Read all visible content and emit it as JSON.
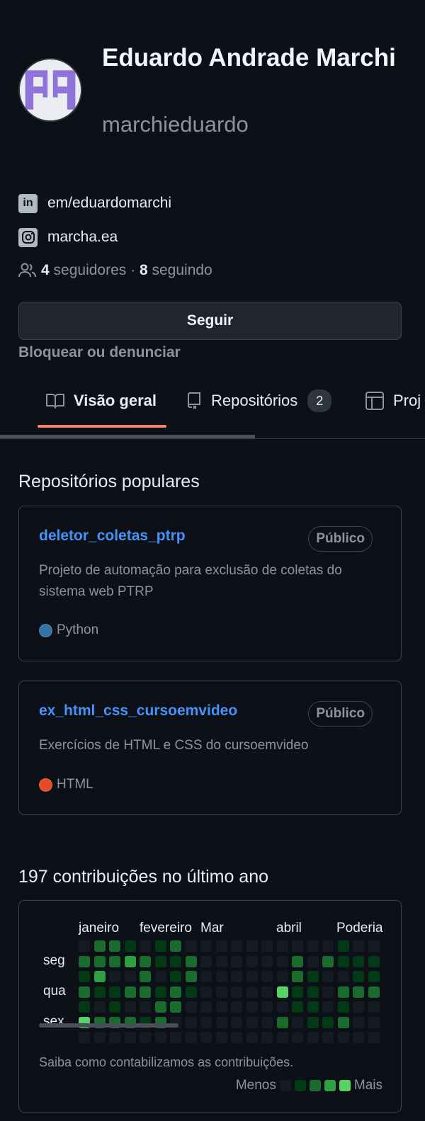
{
  "profile": {
    "name": "Eduardo Andrade Marchi",
    "login": "marchieduardo",
    "linkedin": "em/eduardomarchi",
    "instagram": "marcha.ea",
    "followers_count": "4",
    "followers_label": "seguidores",
    "separator": "·",
    "following_count": "8",
    "following_label": "seguindo",
    "follow_button": "Seguir",
    "block_link": "Bloquear ou denunciar"
  },
  "tabs": [
    {
      "label": "Visão geral",
      "icon": "book-icon",
      "selected": true
    },
    {
      "label": "Repositórios",
      "icon": "repo-icon",
      "count": "2"
    },
    {
      "label": "Proj",
      "icon": "table-icon"
    }
  ],
  "popular": {
    "title": "Repositórios populares",
    "repos": [
      {
        "name": "deletor_coletas_ptrp",
        "visibility": "Público",
        "description": "Projeto de automação para exclusão de coletas do sistema web PTRP",
        "language": "Python",
        "language_color": "#3572A5"
      },
      {
        "name": "ex_html_css_cursoemvideo",
        "visibility": "Público",
        "description": "Exercícios de HTML e CSS do cursoemvideo",
        "language": "HTML",
        "language_color": "#e34c26"
      }
    ]
  },
  "contributions": {
    "title": "197 contribuições no último ano",
    "months": [
      "janeiro",
      "fevereiro",
      "Mar",
      "abril",
      "Poderia"
    ],
    "day_labels": [
      "seg",
      "qua",
      "sex"
    ],
    "learn_link": "Saiba como contabilizamos as contribuições.",
    "legend_less": "Menos",
    "legend_more": "Mais",
    "level_colors": [
      "#151b23",
      "#033a16",
      "#196c2e",
      "#2ea043",
      "#56d364"
    ],
    "grid_levels": [
      [
        0,
        2,
        2,
        1,
        0,
        1,
        2,
        0,
        0,
        0,
        0,
        0,
        0,
        0,
        0,
        0,
        0,
        1,
        0,
        0
      ],
      [
        2,
        2,
        2,
        3,
        2,
        1,
        1,
        2,
        0,
        0,
        0,
        0,
        0,
        0,
        2,
        0,
        2,
        1,
        1,
        1
      ],
      [
        1,
        3,
        0,
        0,
        2,
        0,
        1,
        2,
        0,
        0,
        0,
        0,
        0,
        0,
        2,
        1,
        0,
        0,
        1,
        1
      ],
      [
        2,
        1,
        1,
        2,
        2,
        1,
        2,
        1,
        0,
        0,
        0,
        0,
        0,
        4,
        1,
        1,
        0,
        2,
        2,
        2
      ],
      [
        1,
        0,
        1,
        0,
        0,
        2,
        2,
        0,
        0,
        0,
        0,
        0,
        0,
        0,
        1,
        1,
        0,
        1,
        0,
        0
      ],
      [
        4,
        2,
        2,
        2,
        1,
        2,
        0,
        0,
        0,
        0,
        0,
        0,
        0,
        2,
        0,
        1,
        1,
        2,
        0,
        0
      ],
      [
        0,
        0,
        0,
        0,
        0,
        0,
        0,
        0,
        0,
        0,
        0,
        0,
        0,
        0,
        0,
        0,
        0,
        0,
        0,
        0
      ]
    ]
  }
}
